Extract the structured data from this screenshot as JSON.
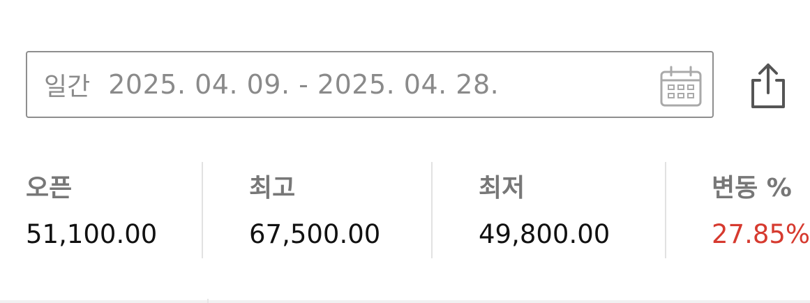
{
  "date_filter": {
    "period": "일간",
    "range": "2025. 04. 09. - 2025. 04. 28.",
    "calendar_icon": "calendar-icon"
  },
  "share": {
    "icon": "share-icon"
  },
  "stats": [
    {
      "label": "오픈",
      "value": "51,100.00"
    },
    {
      "label": "최고",
      "value": "67,500.00"
    },
    {
      "label": "최저",
      "value": "49,800.00"
    },
    {
      "label": "변동 %",
      "value": "27.85%"
    }
  ],
  "colors": {
    "positive": "#d63a2f",
    "label": "#777777",
    "border": "#8e8e8e"
  }
}
